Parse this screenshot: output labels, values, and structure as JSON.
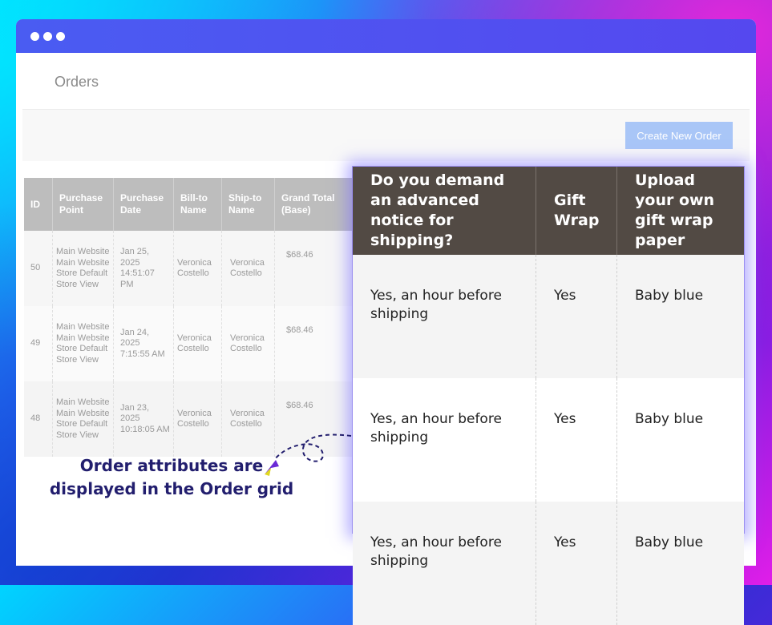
{
  "window": {
    "controls": [
      "dot",
      "dot",
      "dot"
    ]
  },
  "page": {
    "title": "Orders",
    "create_button": "Create New Order"
  },
  "grid": {
    "columns": [
      "ID",
      "Purchase Point",
      "Purchase Date",
      "Bill-to Name",
      "Ship-to Name",
      "Grand Total (Base)"
    ],
    "rows": [
      {
        "id": "50",
        "point": "Main Website Main Website Store Default Store View",
        "date": "Jan 25, 2025 14:51:07 PM",
        "bill": "Veronica Costello",
        "ship": "Veronica Costello",
        "total": "$68.46"
      },
      {
        "id": "49",
        "point": "Main Website Main Website Store Default Store View",
        "date": "Jan 24, 2025 7:15:55 AM",
        "bill": "Veronica Costello",
        "ship": "Veronica Costello",
        "total": "$68.46"
      },
      {
        "id": "48",
        "point": "Main Website Main Website Store Default Store View",
        "date": "Jan 23, 2025 10:18:05 AM",
        "bill": "Veronica Costello",
        "ship": "Veronica Costello",
        "total": "$68.46"
      }
    ]
  },
  "attributes": {
    "columns": [
      "Do you demand an advanced notice for shipping?",
      "Gift Wrap",
      "Upload your own gift wrap paper"
    ],
    "rows": [
      {
        "notice": "Yes, an hour before shipping",
        "gift": "Yes",
        "paper": "Baby blue"
      },
      {
        "notice": "Yes, an hour before shipping",
        "gift": "Yes",
        "paper": "Baby blue"
      },
      {
        "notice": "Yes, an hour before shipping",
        "gift": "Yes",
        "paper": "Baby blue"
      }
    ]
  },
  "caption": "Order attributes are displayed in the Order grid",
  "colors": {
    "titlebar": "#4a5cf2",
    "header_dark": "#524a44",
    "caption": "#221e6e",
    "button": "#a9c6f7"
  },
  "icons": [
    "window-dot-icon",
    "curved-arrow-icon"
  ]
}
